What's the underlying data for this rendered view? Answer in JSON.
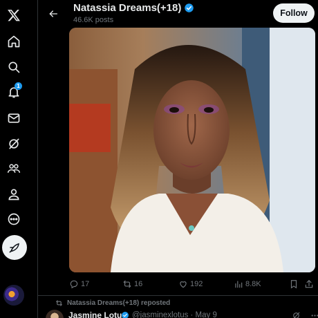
{
  "nav": {
    "items": [
      {
        "name": "x-logo-icon"
      },
      {
        "name": "home-icon"
      },
      {
        "name": "search-icon"
      },
      {
        "name": "notifications-icon",
        "badge": "1"
      },
      {
        "name": "messages-icon"
      },
      {
        "name": "grok-icon"
      },
      {
        "name": "communities-icon"
      },
      {
        "name": "profile-icon"
      },
      {
        "name": "more-icon"
      }
    ],
    "compose_icon": "feather-compose-icon"
  },
  "header": {
    "title": "Natassia Dreams(+18)",
    "posts_count": "46.6K posts",
    "follow_label": "Follow"
  },
  "post": {
    "actions": {
      "replies": "17",
      "reposts": "16",
      "likes": "192",
      "views": "8.8K"
    }
  },
  "next_post": {
    "repost_context": "Natassia Dreams(+18) reposted",
    "author_name": "Jasmine Lotus",
    "author_handle_date": "@jasminexlotus · May 9"
  },
  "colors": {
    "accent": "#1d9bf0",
    "background": "#000000",
    "muted": "#71767b",
    "text": "#e7e9ea"
  }
}
